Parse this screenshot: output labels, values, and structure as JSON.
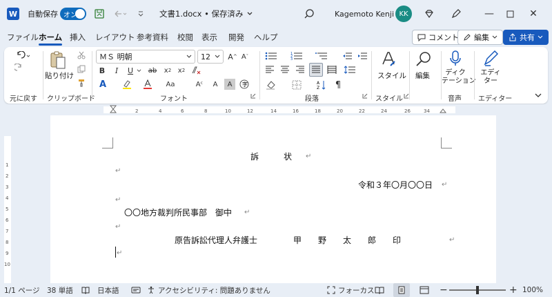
{
  "titlebar": {
    "app_icon": "word-logo",
    "autosave_label": "自動保存",
    "autosave_state": "オン",
    "doc_title": "文書1.docx • 保存済み",
    "user_name": "Kagemoto Kenji",
    "user_initials": "KK"
  },
  "menu": {
    "tabs": [
      "ファイル",
      "ホーム",
      "挿入",
      "レイアウト",
      "参考資料",
      "校閲",
      "表示",
      "開発",
      "ヘルプ"
    ],
    "active_tab": "ホーム",
    "comment_label": "コメント",
    "edit_label": "編集",
    "share_label": "共有"
  },
  "ribbon": {
    "groups": {
      "undo": "元に戻す",
      "clipboard": "クリップボード",
      "font": "フォント",
      "paragraph": "段落",
      "style": "スタイル",
      "voice": "音声",
      "editor": "エディター"
    },
    "paste_label": "貼り付け",
    "font_name": "ＭＳ 明朝",
    "font_size": "12",
    "style_label": "スタイル",
    "edit_label": "編集",
    "dictate_label": "ディク\nテーション",
    "editor_label": "エディ\nター"
  },
  "document": {
    "title": "訴　　　状",
    "date": "令和３年〇月〇〇日",
    "court": "〇〇地方裁判所民事部　御中",
    "signer_role": "原告訴訟代理人弁護士",
    "signer_name": "甲　　野　　太　　郎　　印"
  },
  "status": {
    "page": "1/1 ページ",
    "words": "38 単語",
    "language": "日本語",
    "accessibility": "アクセシビリティ: 問題ありません",
    "focus": "フォーカス",
    "zoom": "100%",
    "zoom_level": 1.0
  },
  "colors": {
    "accent": "#185abd",
    "avatar": "#1a8c84",
    "toggle": "#0f6cbd"
  }
}
